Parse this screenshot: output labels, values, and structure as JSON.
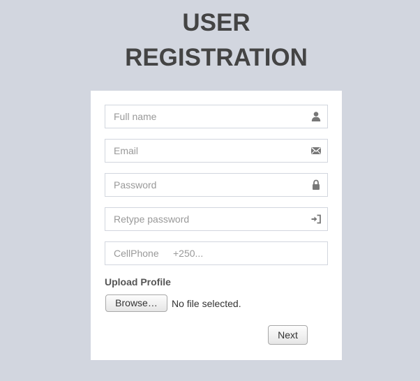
{
  "header": {
    "title_line1": "USER",
    "title_line2": "REGISTRATION"
  },
  "form": {
    "fullname": {
      "placeholder": "Full name",
      "value": "",
      "icon": "user-icon"
    },
    "email": {
      "placeholder": "Email",
      "value": "",
      "icon": "envelope-icon"
    },
    "password": {
      "placeholder": "Password",
      "value": "",
      "icon": "lock-icon"
    },
    "retype_password": {
      "placeholder": "Retype password",
      "value": "",
      "icon": "sign-in-icon"
    },
    "cellphone": {
      "label": "CellPhone",
      "placeholder": "+250...",
      "value": ""
    },
    "upload": {
      "label": "Upload Profile",
      "browse_label": "Browse…",
      "status": "No file selected."
    },
    "next_label": "Next"
  },
  "colors": {
    "background": "#d2d6df",
    "card": "#ffffff",
    "title": "#444444",
    "icon": "#777777"
  }
}
